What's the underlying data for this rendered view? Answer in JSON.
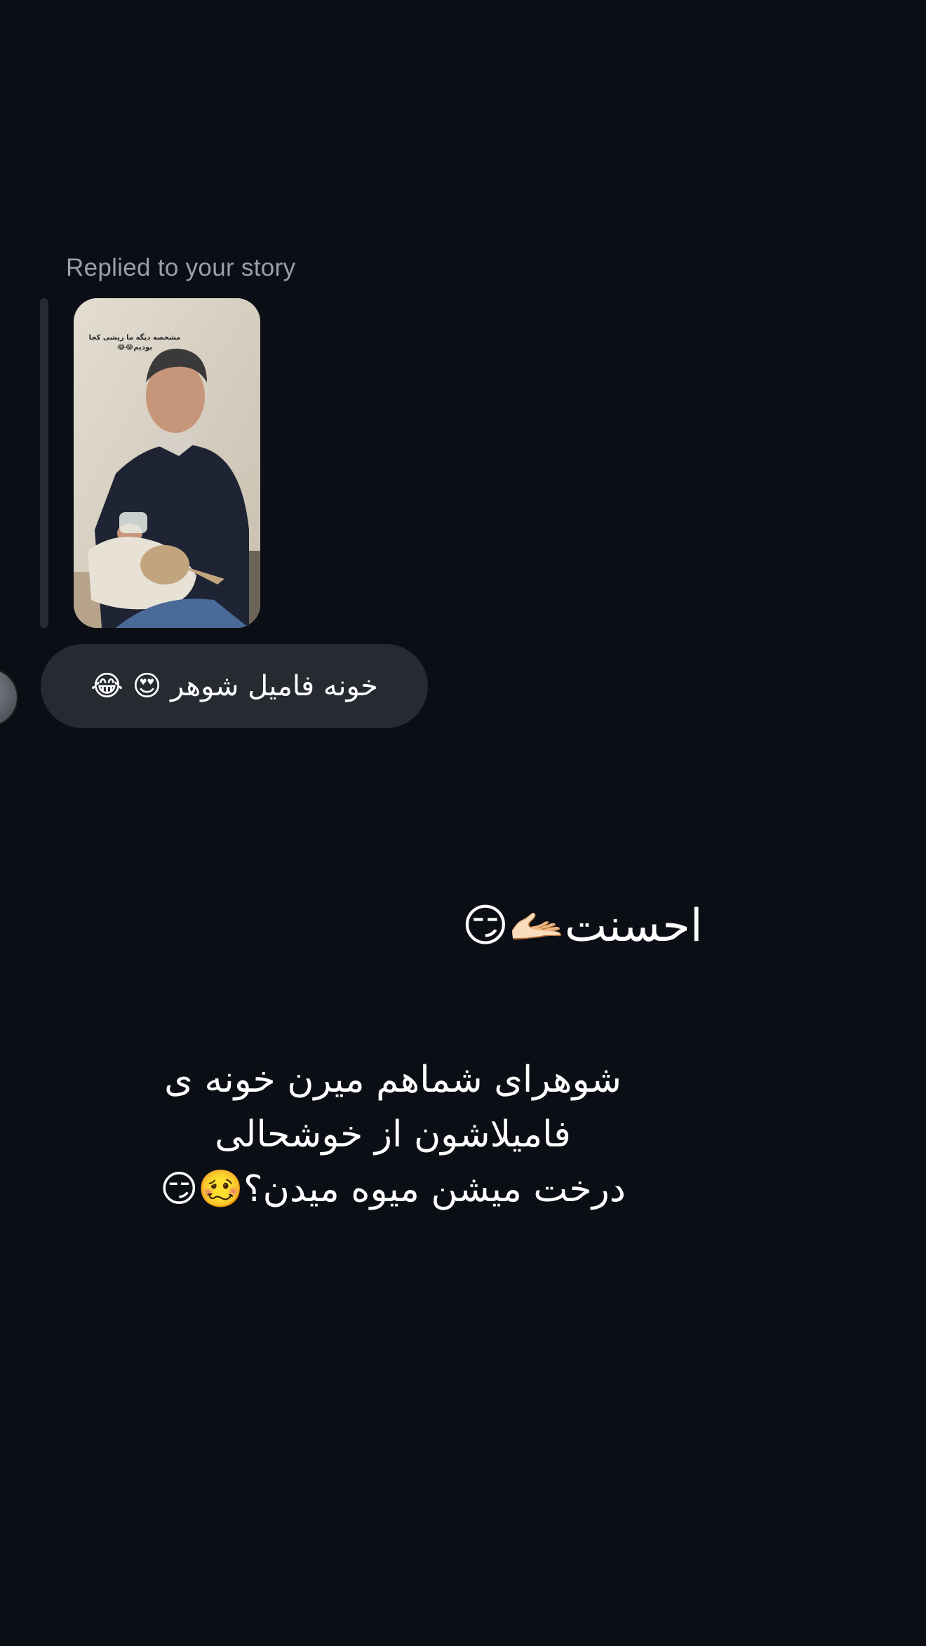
{
  "conversation": {
    "reply_context": "Replied to your story",
    "story": {
      "caption_line_1": "مشخصه دیگه ما ریشی کجا",
      "caption_line_2": "بودیم😂😂"
    },
    "message": {
      "text": "خونه فامیل شوهر 😍 😂"
    }
  },
  "story_overlay": {
    "line_1": "احسنت🫴🏻😏",
    "line_2a": "شوهرای شماهم میرن خونه ی",
    "line_2b": "فامیلاشون از خوشحالی",
    "line_2c": "درخت میشن میوه میدن؟🥴😏"
  },
  "colors": {
    "background": "#0b0e14",
    "bubble": "#262a31",
    "secondary_text": "#9aa0aa"
  }
}
